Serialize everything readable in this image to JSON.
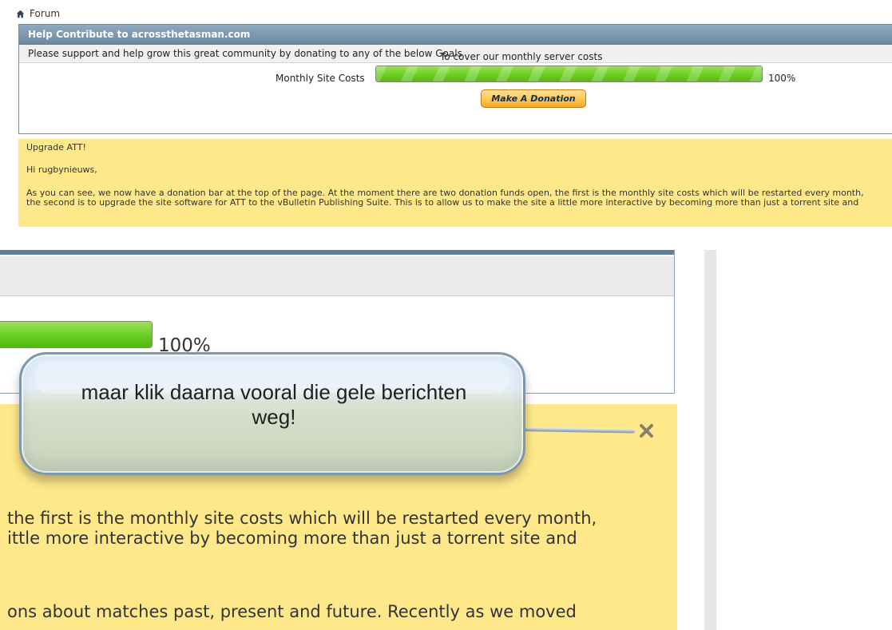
{
  "forum": {
    "label": "Forum"
  },
  "donation": {
    "header": "Help Contribute to acrossthetasman.com",
    "intro": "Please support and help grow this great community by donating to any of the below Goals",
    "goal_title": "To cover our monthly server costs",
    "goal_label": "Monthly Site Costs",
    "progress": 1.0,
    "percent_label": "100%",
    "button_label": "Make A Donation"
  },
  "notice": {
    "title": "Upgrade ATT!",
    "greeting": "Hi rugbynieuws,",
    "line1": "As you can see, we now have a donation bar at the top of the page. At the moment there are two donation funds open, the first is the monthly site costs which will be restarted every month,",
    "line2": "the second is to upgrade the site software for ATT to the vBulletin Publishing Suite. This is to allow us to make the site a little more interactive by becoming more than just a torrent site and"
  },
  "zoom": {
    "percent_label": "100%",
    "line1": " the first is the monthly site costs which will be restarted every month,",
    "line2": "ittle more interactive by becoming more than just a torrent site and",
    "line3": "ons about matches past, present and future. Recently as we moved"
  },
  "callout": {
    "text": "maar klik daarna vooral die gele berichten weg!"
  },
  "icons": {
    "home": "home-icon",
    "close": "close-icon"
  },
  "colors": {
    "header_blue": "#6e8aa3",
    "progress_green": "#6ccf21",
    "notice_yellow": "#ffe88a",
    "button_orange": "#ffc44e",
    "callout_border": "#7e97aa"
  }
}
